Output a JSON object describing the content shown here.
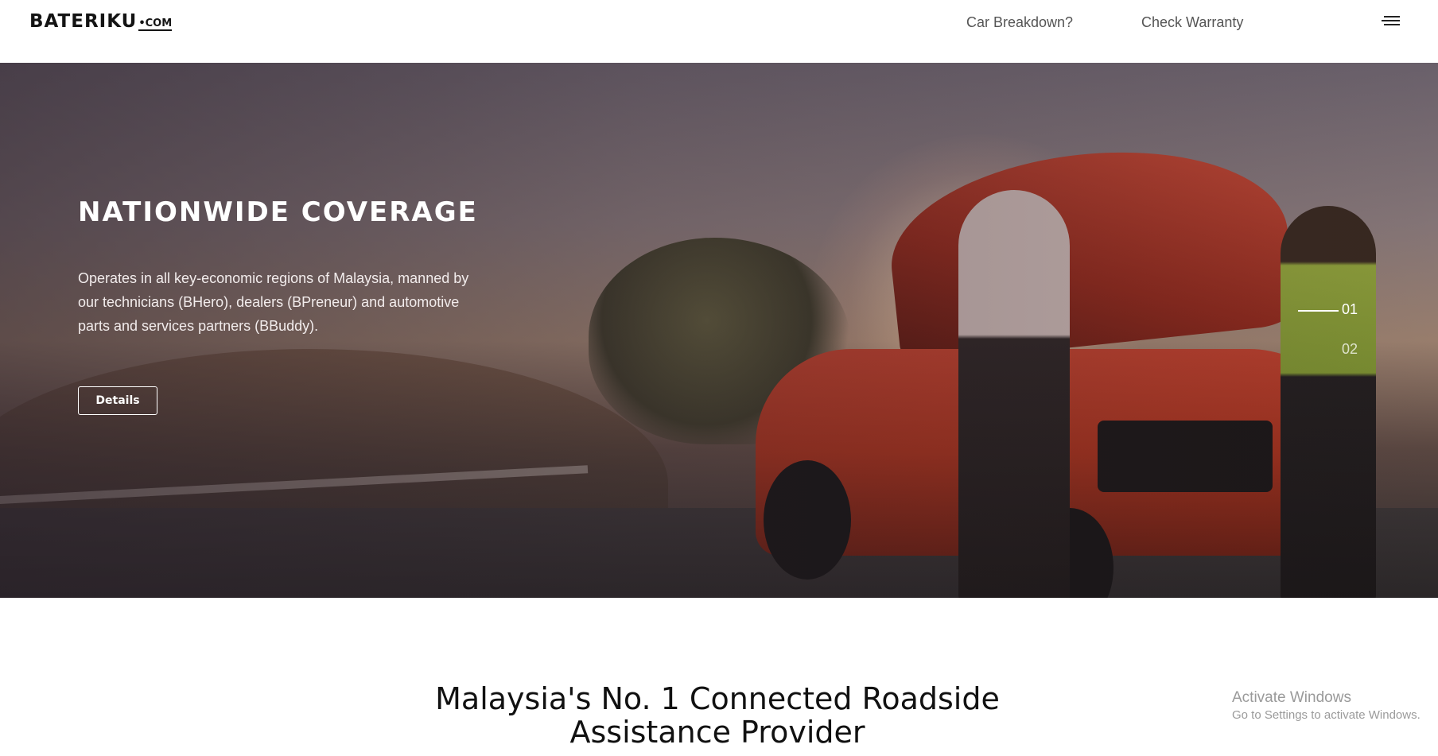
{
  "header": {
    "logo_main": "BATERIKU",
    "logo_com": "•COM",
    "nav": {
      "car_breakdown": "Car Breakdown?",
      "check_warranty": "Check Warranty"
    },
    "menu_icon": "hamburger-menu-icon"
  },
  "hero": {
    "title": "NATIONWIDE COVERAGE",
    "description": "Operates in all key-economic regions of Malaysia, manned by our technicians (BHero), dealers (BPreneur) and automotive parts and services partners (BBuddy).",
    "button_label": "Details",
    "slides": [
      {
        "label": "01",
        "active": true
      },
      {
        "label": "02",
        "active": false
      }
    ]
  },
  "section": {
    "heading_line1": "Malaysia's No. 1 Connected Roadside",
    "heading_line2": "Assistance Provider"
  },
  "watermark": {
    "title": "Activate Windows",
    "subtitle": "Go to Settings to activate Windows."
  },
  "colors": {
    "nav_text": "#555555",
    "heading_text": "#111111",
    "hero_text": "#ffffff",
    "watermark_text": "#9a9a9a"
  }
}
